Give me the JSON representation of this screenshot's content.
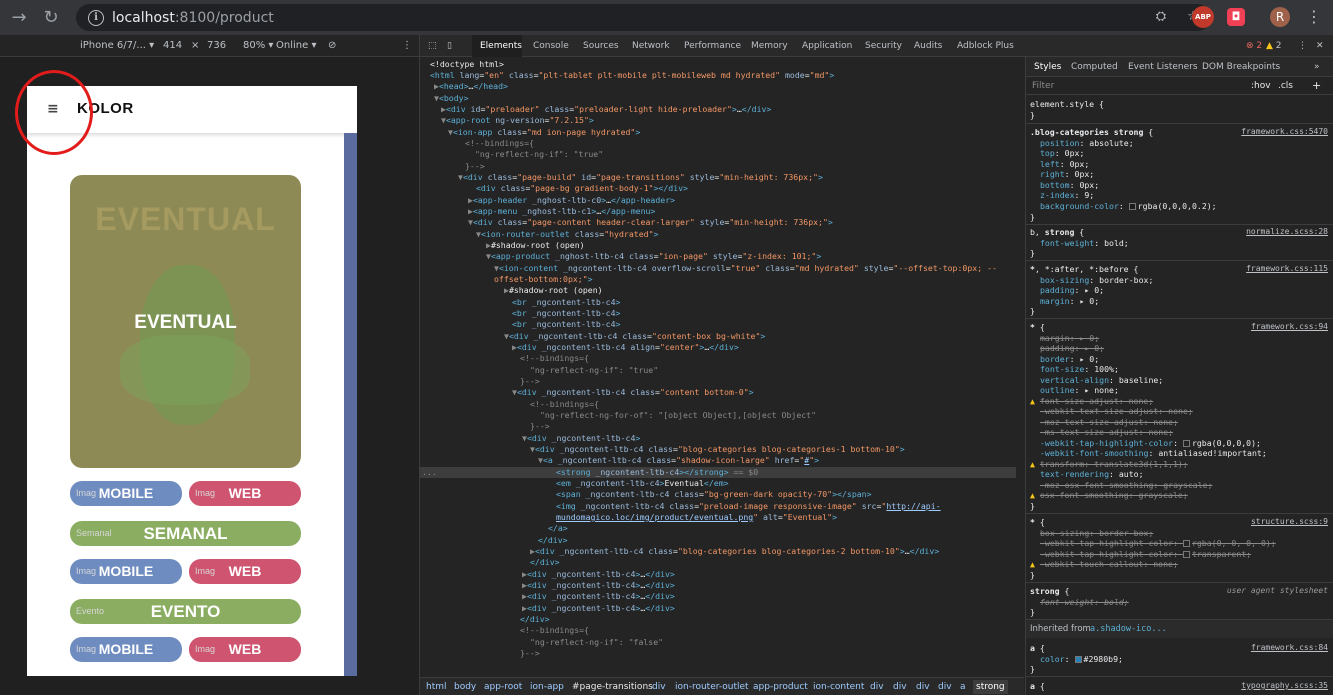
{
  "browser": {
    "url_host": "localhost",
    "url_port_path": ":8100/product",
    "avatar_letter": "R",
    "abp_label": "ABP"
  },
  "device_bar": {
    "device": "iPhone 6/7/...",
    "width": "414",
    "times": "×",
    "height": "736",
    "zoom": "80%",
    "network": "Online"
  },
  "phone": {
    "brand": "KOLOR",
    "card_logo_text": "EVENTUAL",
    "card_title": "EVENTUAL",
    "rows": [
      {
        "left_alt": "Imag",
        "left": "MOBILE",
        "right_alt": "Imag",
        "right": "WEB"
      },
      {
        "wide_alt": "Semanal",
        "wide": "SEMANAL"
      },
      {
        "left_alt": "Imag",
        "left": "MOBILE",
        "right_alt": "Imag",
        "right": "WEB"
      },
      {
        "wide_alt": "Evento",
        "wide": "EVENTO"
      },
      {
        "left_alt": "Imag",
        "left": "MOBILE",
        "right_alt": "Imag",
        "right": "WEB"
      }
    ]
  },
  "devtools": {
    "tabs": [
      "Elements",
      "Console",
      "Sources",
      "Network",
      "Performance",
      "Memory",
      "Application",
      "Security",
      "Audits",
      "Adblock Plus"
    ],
    "errors": "2",
    "warnings": "2",
    "breadcrumbs": [
      "html",
      "body",
      "app-root",
      "ion-app",
      "#page-transitions",
      "div",
      "ion-router-outlet",
      "app-product",
      "ion-content",
      "div",
      "div",
      "div",
      "div",
      "a",
      "strong"
    ],
    "styles_tabs": [
      "Styles",
      "Computed",
      "Event Listeners",
      "DOM Breakpoints"
    ],
    "filter_placeholder": "Filter",
    "hov": ":hov",
    "cls": ".cls",
    "inherited_from": "Inherited from",
    "inherited_selector": "a.shadow-ico..."
  },
  "colors": {
    "pill_blue": "#6e8cc0",
    "pill_red": "#cf5470",
    "pill_green": "#8aad62",
    "annotation_circle": "#e21b1b"
  }
}
